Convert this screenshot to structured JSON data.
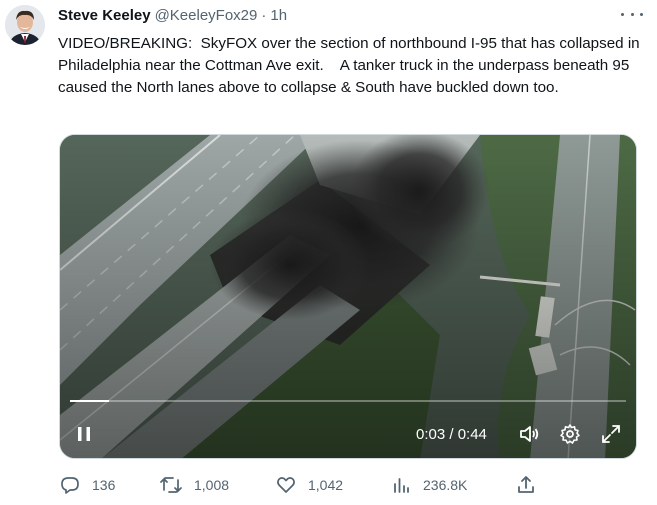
{
  "user": {
    "name": "Steve Keeley",
    "handle": "@KeeleyFox29",
    "separator": "·",
    "time": "1h"
  },
  "tweet": {
    "text": "VIDEO/BREAKING:  SkyFOX over the section of northbound I-95 that has collapsed in Philadelphia near the Cottman Ave exit.    A tanker truck in the underpass beneath 95 caused the North lanes above to collapse & South have buckled down too."
  },
  "video": {
    "time_readout": "0:03 / 0:44",
    "progress": 0.07
  },
  "actions": {
    "replies": "136",
    "retweets": "1,008",
    "likes": "1,042",
    "views": "236.8K"
  },
  "icons": {
    "more": "more-dots-icon",
    "pause": "pause-icon",
    "volume": "volume-icon",
    "settings": "gear-icon",
    "fullscreen": "fullscreen-icon",
    "reply": "reply-icon",
    "retweet": "retweet-icon",
    "like": "heart-icon",
    "views": "views-chart-icon",
    "share": "share-icon"
  },
  "colors": {
    "text": "#0f1419",
    "secondary": "#536471"
  }
}
